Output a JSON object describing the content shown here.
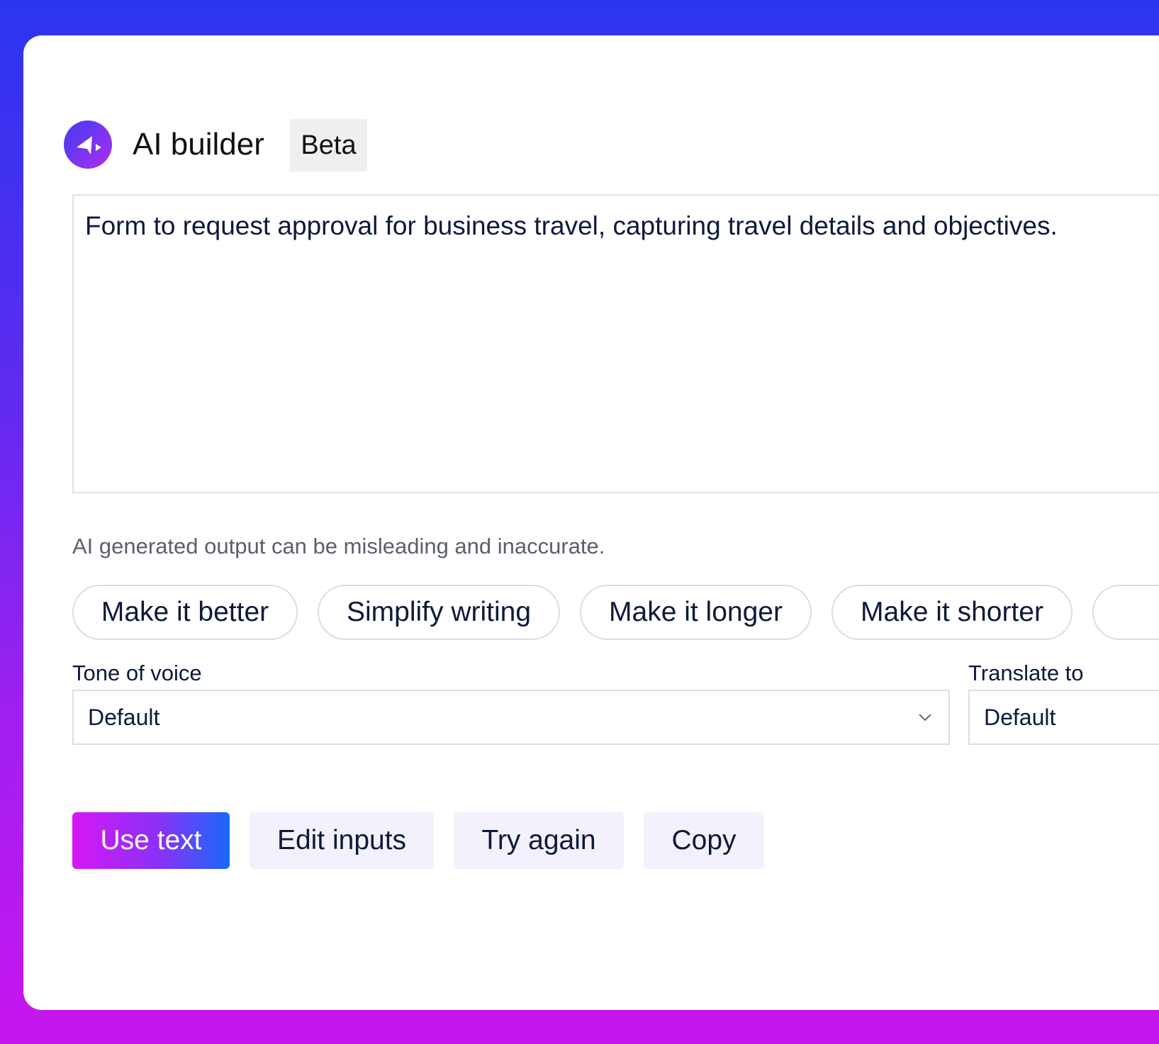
{
  "header": {
    "title": "AI builder",
    "badge": "Beta",
    "logo_icon": "paper-plane-arrow-icon"
  },
  "editor": {
    "text": "Form to request approval for business travel, capturing travel details and objectives.",
    "disclaimer": "AI generated output can be misleading and inaccurate."
  },
  "chips": [
    {
      "label": "Make it better"
    },
    {
      "label": "Simplify writing"
    },
    {
      "label": "Make it longer"
    },
    {
      "label": "Make it shorter"
    },
    {
      "label": ""
    }
  ],
  "tone": {
    "label": "Tone of voice",
    "value": "Default"
  },
  "translate": {
    "label": "Translate to",
    "value": "Default"
  },
  "actions": {
    "use_text": "Use text",
    "edit_inputs": "Edit inputs",
    "try_again": "Try again",
    "copy": "Copy"
  },
  "colors": {
    "accent_gradient_start": "#d617f5",
    "accent_gradient_end": "#1869f8",
    "logo_start": "#3d3ef3",
    "logo_end": "#b02cf0",
    "text": "#0c1a3b"
  }
}
